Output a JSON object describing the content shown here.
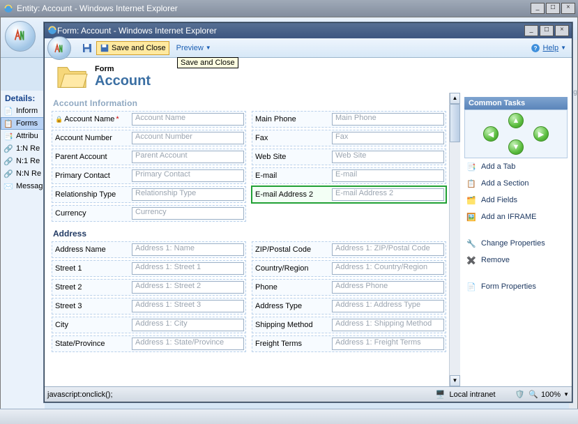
{
  "outer_window": {
    "title": "Entity: Account - Windows Internet Explorer"
  },
  "details_panel": {
    "title": "Details:",
    "items": [
      {
        "label": "Inform"
      },
      {
        "label": "Forms "
      },
      {
        "label": "Attribu"
      },
      {
        "label": "1:N Re"
      },
      {
        "label": "N:1 Re"
      },
      {
        "label": "N:N Re"
      },
      {
        "label": "Messag"
      }
    ]
  },
  "inner_window": {
    "title": "Form: Account - Windows Internet Explorer"
  },
  "toolbar": {
    "save_close_label": "Save and Close",
    "preview_label": "Preview",
    "help_label": "Help",
    "tooltip": "Save and Close"
  },
  "form_header": {
    "supertitle": "Form",
    "title": "Account"
  },
  "sections": {
    "account_info": "Account Information",
    "address": "Address"
  },
  "fields": {
    "left1": [
      {
        "label": "Account Name",
        "ph": "Account Name",
        "required": true,
        "locked": true
      },
      {
        "label": "Account Number",
        "ph": "Account Number"
      },
      {
        "label": "Parent Account",
        "ph": "Parent Account"
      },
      {
        "label": "Primary Contact",
        "ph": "Primary Contact"
      },
      {
        "label": "Relationship Type",
        "ph": "Relationship Type"
      },
      {
        "label": "Currency",
        "ph": "Currency"
      }
    ],
    "right1": [
      {
        "label": "Main Phone",
        "ph": "Main Phone"
      },
      {
        "label": "Fax",
        "ph": "Fax"
      },
      {
        "label": "Web Site",
        "ph": "Web Site"
      },
      {
        "label": "E-mail",
        "ph": "E-mail"
      },
      {
        "label": "E-mail Address 2",
        "ph": "E-mail Address 2",
        "highlight": true
      }
    ],
    "left2": [
      {
        "label": "Address Name",
        "ph": "Address 1: Name"
      },
      {
        "label": "Street 1",
        "ph": "Address 1: Street 1"
      },
      {
        "label": "Street 2",
        "ph": "Address 1: Street 2"
      },
      {
        "label": "Street 3",
        "ph": "Address 1: Street 3"
      },
      {
        "label": "City",
        "ph": "Address 1: City"
      },
      {
        "label": "State/Province",
        "ph": "Address 1: State/Province"
      }
    ],
    "right2": [
      {
        "label": "ZIP/Postal Code",
        "ph": "Address 1: ZIP/Postal Code"
      },
      {
        "label": "Country/Region",
        "ph": "Address 1: Country/Region"
      },
      {
        "label": "Phone",
        "ph": "Address Phone"
      },
      {
        "label": "Address Type",
        "ph": "Address 1: Address Type"
      },
      {
        "label": "Shipping Method",
        "ph": "Address 1: Shipping Method"
      },
      {
        "label": "Freight Terms",
        "ph": "Address 1: Freight Terms"
      }
    ]
  },
  "common_tasks": {
    "header": "Common Tasks",
    "tasks1": [
      {
        "label": "Add a Tab"
      },
      {
        "label": "Add a Section"
      },
      {
        "label": "Add Fields"
      },
      {
        "label": "Add an IFRAME"
      }
    ],
    "tasks2": [
      {
        "label": "Change Properties"
      },
      {
        "label": "Remove"
      }
    ],
    "tasks3": [
      {
        "label": "Form Properties"
      }
    ]
  },
  "status": {
    "text": "javascript:onclick();",
    "zone": "Local intranet",
    "zoom": "100%"
  }
}
